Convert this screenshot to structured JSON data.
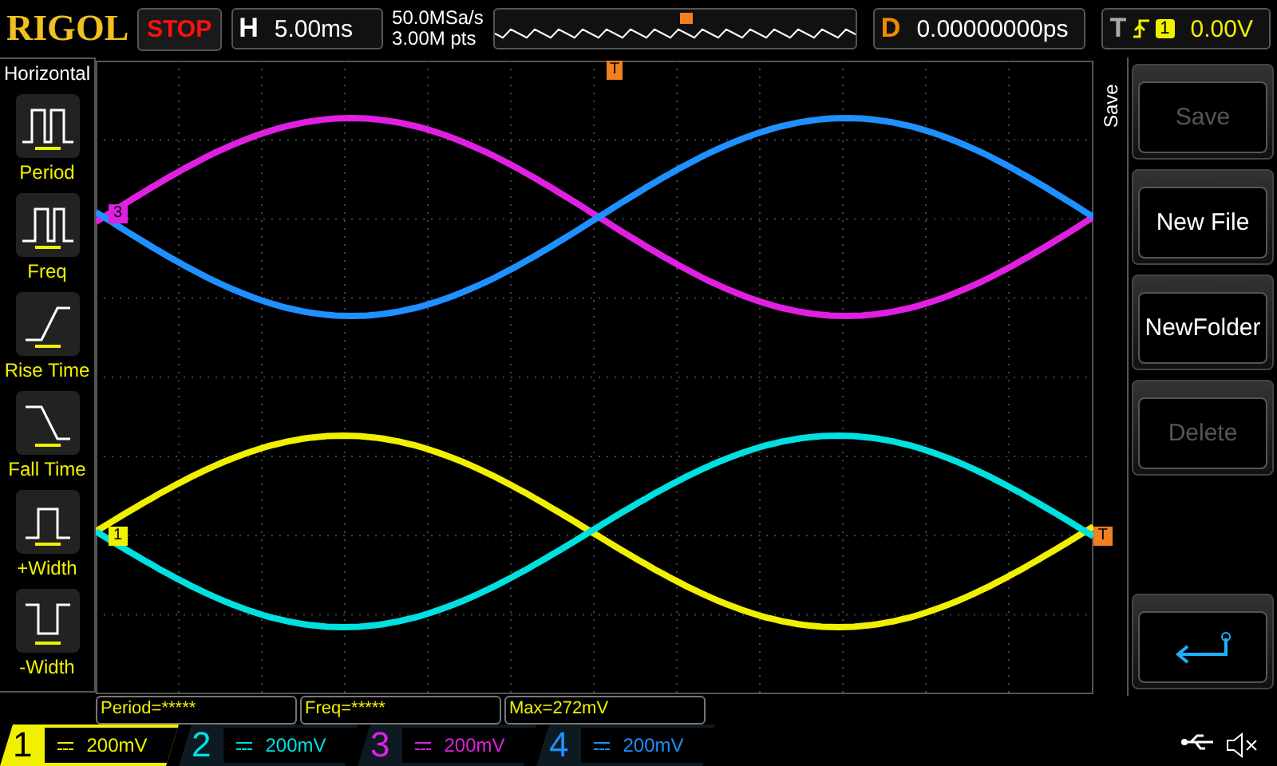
{
  "header": {
    "logo": "RIGOL",
    "run_state": "STOP",
    "timebase_label": "H",
    "timebase": "5.00ms",
    "sample_rate": "50.0MSa/s",
    "memory_depth": "3.00M pts",
    "delay_label": "D",
    "delay": "0.00000000ps",
    "trigger_label": "T",
    "trigger_source": "1",
    "trigger_level": "0.00V"
  },
  "left_menu": {
    "title": "Horizontal",
    "items": [
      {
        "label": "Period"
      },
      {
        "label": "Freq"
      },
      {
        "label": "Rise Time"
      },
      {
        "label": "Fall Time"
      },
      {
        "label": "+Width"
      },
      {
        "label": "-Width"
      }
    ]
  },
  "markers": [
    {
      "label": "3",
      "color": "#e020e0"
    },
    {
      "label": "1",
      "color": "#f0f000"
    }
  ],
  "trigger_marker": "T",
  "trigger_time_marker": "T",
  "right_menu": {
    "title": "Save",
    "buttons": [
      {
        "kind": "text",
        "label": "Save",
        "disabled": true
      },
      {
        "kind": "text",
        "label": "New File",
        "disabled": false
      },
      {
        "kind": "text",
        "label": "NewFolder",
        "disabled": false
      },
      {
        "kind": "text",
        "label": "Delete",
        "disabled": true
      },
      {
        "kind": "back",
        "disabled": false
      }
    ]
  },
  "measurements": [
    "Period=*****",
    "Freq=*****",
    "Max=272mV"
  ],
  "channels": [
    {
      "label": "1",
      "scale": "200mV",
      "color": "#f0f000",
      "selected": true
    },
    {
      "label": "2",
      "scale": "200mV",
      "color": "#00e0e0",
      "selected": false
    },
    {
      "label": "3",
      "scale": "200mV",
      "color": "#e020e0",
      "selected": false
    },
    {
      "label": "4",
      "scale": "200mV",
      "color": "#1e90ff",
      "selected": false
    }
  ]
}
